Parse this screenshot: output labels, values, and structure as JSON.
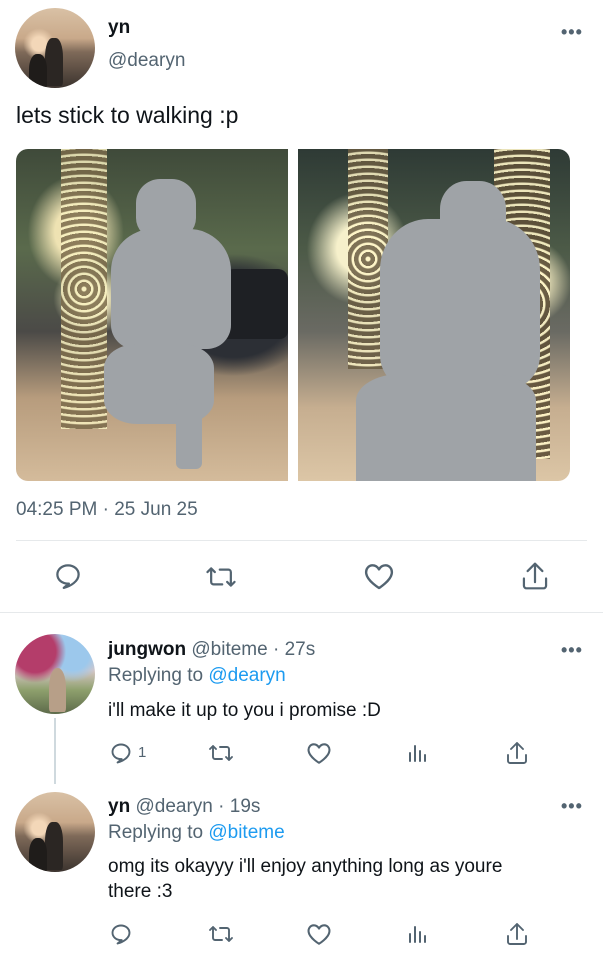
{
  "main_tweet": {
    "author_name": "yn",
    "author_handle": "@dearyn",
    "text": "lets stick to walking :p",
    "timestamp": "04:25 PM · 25 Jun 25",
    "more_icon": "ellipsis-icon",
    "actions": [
      "reply-icon",
      "retweet-icon",
      "like-icon",
      "share-icon"
    ]
  },
  "replies": [
    {
      "author_name": "jungwon",
      "author_handle": "@biteme",
      "time": "· 27s",
      "replying_prefix": "Replying to",
      "replying_to": "@dearyn",
      "text": "i'll make it up to you i promise :D",
      "reply_count": "1"
    },
    {
      "author_name": "yn",
      "author_handle": "@dearyn",
      "time": "· 19s",
      "replying_prefix": "Replying to",
      "replying_to": "@biteme",
      "text_line1": "omg its okayyy i'll enjoy anything long as youre",
      "text_line2": "there :3"
    }
  ],
  "colors": {
    "link": "#1d9bf0",
    "muted": "#536471",
    "text": "#0f1419",
    "divider": "#e6e9eb"
  }
}
